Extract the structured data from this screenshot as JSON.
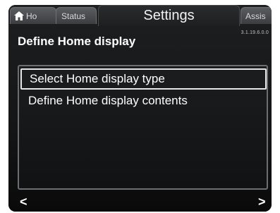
{
  "tabs": {
    "home": "Ho",
    "status": "Status",
    "settings": "Settings",
    "assist": "Assis"
  },
  "version": "3.1.19.6.0.0",
  "page_title": "Define Home display",
  "menu": {
    "items": [
      {
        "label": "Select Home display type",
        "selected": true
      },
      {
        "label": "Define Home display contents",
        "selected": false
      }
    ]
  },
  "nav": {
    "left_icon": "chevron-left-icon",
    "right_icon": "chevron-right-icon",
    "left_glyph": "<",
    "right_glyph": ">"
  },
  "colors": {
    "background": "#141516",
    "tab": "#4a4c4f",
    "selection_border": "#e6e6e6",
    "text": "#ffffff"
  }
}
